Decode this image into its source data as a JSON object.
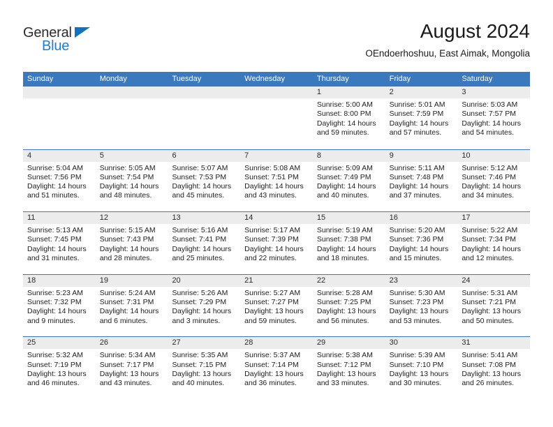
{
  "brand": {
    "name_top": "General",
    "name_bottom": "Blue",
    "triangle_icon": "triangle-icon",
    "accent_blue": "#1b7fd4",
    "header_blue": "#3a79bd"
  },
  "header": {
    "title": "August 2024",
    "subtitle": "OEndoerhoshuu, East Aimak, Mongolia"
  },
  "calendar": {
    "weekday_headers": [
      "Sunday",
      "Monday",
      "Tuesday",
      "Wednesday",
      "Thursday",
      "Friday",
      "Saturday"
    ],
    "weeks": [
      [
        {
          "day": "",
          "sunrise": "",
          "sunset": "",
          "daylight_line1": "",
          "daylight_line2": ""
        },
        {
          "day": "",
          "sunrise": "",
          "sunset": "",
          "daylight_line1": "",
          "daylight_line2": ""
        },
        {
          "day": "",
          "sunrise": "",
          "sunset": "",
          "daylight_line1": "",
          "daylight_line2": ""
        },
        {
          "day": "",
          "sunrise": "",
          "sunset": "",
          "daylight_line1": "",
          "daylight_line2": ""
        },
        {
          "day": "1",
          "sunrise": "Sunrise: 5:00 AM",
          "sunset": "Sunset: 8:00 PM",
          "daylight_line1": "Daylight: 14 hours",
          "daylight_line2": "and 59 minutes."
        },
        {
          "day": "2",
          "sunrise": "Sunrise: 5:01 AM",
          "sunset": "Sunset: 7:59 PM",
          "daylight_line1": "Daylight: 14 hours",
          "daylight_line2": "and 57 minutes."
        },
        {
          "day": "3",
          "sunrise": "Sunrise: 5:03 AM",
          "sunset": "Sunset: 7:57 PM",
          "daylight_line1": "Daylight: 14 hours",
          "daylight_line2": "and 54 minutes."
        }
      ],
      [
        {
          "day": "4",
          "sunrise": "Sunrise: 5:04 AM",
          "sunset": "Sunset: 7:56 PM",
          "daylight_line1": "Daylight: 14 hours",
          "daylight_line2": "and 51 minutes."
        },
        {
          "day": "5",
          "sunrise": "Sunrise: 5:05 AM",
          "sunset": "Sunset: 7:54 PM",
          "daylight_line1": "Daylight: 14 hours",
          "daylight_line2": "and 48 minutes."
        },
        {
          "day": "6",
          "sunrise": "Sunrise: 5:07 AM",
          "sunset": "Sunset: 7:53 PM",
          "daylight_line1": "Daylight: 14 hours",
          "daylight_line2": "and 45 minutes."
        },
        {
          "day": "7",
          "sunrise": "Sunrise: 5:08 AM",
          "sunset": "Sunset: 7:51 PM",
          "daylight_line1": "Daylight: 14 hours",
          "daylight_line2": "and 43 minutes."
        },
        {
          "day": "8",
          "sunrise": "Sunrise: 5:09 AM",
          "sunset": "Sunset: 7:49 PM",
          "daylight_line1": "Daylight: 14 hours",
          "daylight_line2": "and 40 minutes."
        },
        {
          "day": "9",
          "sunrise": "Sunrise: 5:11 AM",
          "sunset": "Sunset: 7:48 PM",
          "daylight_line1": "Daylight: 14 hours",
          "daylight_line2": "and 37 minutes."
        },
        {
          "day": "10",
          "sunrise": "Sunrise: 5:12 AM",
          "sunset": "Sunset: 7:46 PM",
          "daylight_line1": "Daylight: 14 hours",
          "daylight_line2": "and 34 minutes."
        }
      ],
      [
        {
          "day": "11",
          "sunrise": "Sunrise: 5:13 AM",
          "sunset": "Sunset: 7:45 PM",
          "daylight_line1": "Daylight: 14 hours",
          "daylight_line2": "and 31 minutes."
        },
        {
          "day": "12",
          "sunrise": "Sunrise: 5:15 AM",
          "sunset": "Sunset: 7:43 PM",
          "daylight_line1": "Daylight: 14 hours",
          "daylight_line2": "and 28 minutes."
        },
        {
          "day": "13",
          "sunrise": "Sunrise: 5:16 AM",
          "sunset": "Sunset: 7:41 PM",
          "daylight_line1": "Daylight: 14 hours",
          "daylight_line2": "and 25 minutes."
        },
        {
          "day": "14",
          "sunrise": "Sunrise: 5:17 AM",
          "sunset": "Sunset: 7:39 PM",
          "daylight_line1": "Daylight: 14 hours",
          "daylight_line2": "and 22 minutes."
        },
        {
          "day": "15",
          "sunrise": "Sunrise: 5:19 AM",
          "sunset": "Sunset: 7:38 PM",
          "daylight_line1": "Daylight: 14 hours",
          "daylight_line2": "and 18 minutes."
        },
        {
          "day": "16",
          "sunrise": "Sunrise: 5:20 AM",
          "sunset": "Sunset: 7:36 PM",
          "daylight_line1": "Daylight: 14 hours",
          "daylight_line2": "and 15 minutes."
        },
        {
          "day": "17",
          "sunrise": "Sunrise: 5:22 AM",
          "sunset": "Sunset: 7:34 PM",
          "daylight_line1": "Daylight: 14 hours",
          "daylight_line2": "and 12 minutes."
        }
      ],
      [
        {
          "day": "18",
          "sunrise": "Sunrise: 5:23 AM",
          "sunset": "Sunset: 7:32 PM",
          "daylight_line1": "Daylight: 14 hours",
          "daylight_line2": "and 9 minutes."
        },
        {
          "day": "19",
          "sunrise": "Sunrise: 5:24 AM",
          "sunset": "Sunset: 7:31 PM",
          "daylight_line1": "Daylight: 14 hours",
          "daylight_line2": "and 6 minutes."
        },
        {
          "day": "20",
          "sunrise": "Sunrise: 5:26 AM",
          "sunset": "Sunset: 7:29 PM",
          "daylight_line1": "Daylight: 14 hours",
          "daylight_line2": "and 3 minutes."
        },
        {
          "day": "21",
          "sunrise": "Sunrise: 5:27 AM",
          "sunset": "Sunset: 7:27 PM",
          "daylight_line1": "Daylight: 13 hours",
          "daylight_line2": "and 59 minutes."
        },
        {
          "day": "22",
          "sunrise": "Sunrise: 5:28 AM",
          "sunset": "Sunset: 7:25 PM",
          "daylight_line1": "Daylight: 13 hours",
          "daylight_line2": "and 56 minutes."
        },
        {
          "day": "23",
          "sunrise": "Sunrise: 5:30 AM",
          "sunset": "Sunset: 7:23 PM",
          "daylight_line1": "Daylight: 13 hours",
          "daylight_line2": "and 53 minutes."
        },
        {
          "day": "24",
          "sunrise": "Sunrise: 5:31 AM",
          "sunset": "Sunset: 7:21 PM",
          "daylight_line1": "Daylight: 13 hours",
          "daylight_line2": "and 50 minutes."
        }
      ],
      [
        {
          "day": "25",
          "sunrise": "Sunrise: 5:32 AM",
          "sunset": "Sunset: 7:19 PM",
          "daylight_line1": "Daylight: 13 hours",
          "daylight_line2": "and 46 minutes."
        },
        {
          "day": "26",
          "sunrise": "Sunrise: 5:34 AM",
          "sunset": "Sunset: 7:17 PM",
          "daylight_line1": "Daylight: 13 hours",
          "daylight_line2": "and 43 minutes."
        },
        {
          "day": "27",
          "sunrise": "Sunrise: 5:35 AM",
          "sunset": "Sunset: 7:15 PM",
          "daylight_line1": "Daylight: 13 hours",
          "daylight_line2": "and 40 minutes."
        },
        {
          "day": "28",
          "sunrise": "Sunrise: 5:37 AM",
          "sunset": "Sunset: 7:14 PM",
          "daylight_line1": "Daylight: 13 hours",
          "daylight_line2": "and 36 minutes."
        },
        {
          "day": "29",
          "sunrise": "Sunrise: 5:38 AM",
          "sunset": "Sunset: 7:12 PM",
          "daylight_line1": "Daylight: 13 hours",
          "daylight_line2": "and 33 minutes."
        },
        {
          "day": "30",
          "sunrise": "Sunrise: 5:39 AM",
          "sunset": "Sunset: 7:10 PM",
          "daylight_line1": "Daylight: 13 hours",
          "daylight_line2": "and 30 minutes."
        },
        {
          "day": "31",
          "sunrise": "Sunrise: 5:41 AM",
          "sunset": "Sunset: 7:08 PM",
          "daylight_line1": "Daylight: 13 hours",
          "daylight_line2": "and 26 minutes."
        }
      ]
    ]
  }
}
